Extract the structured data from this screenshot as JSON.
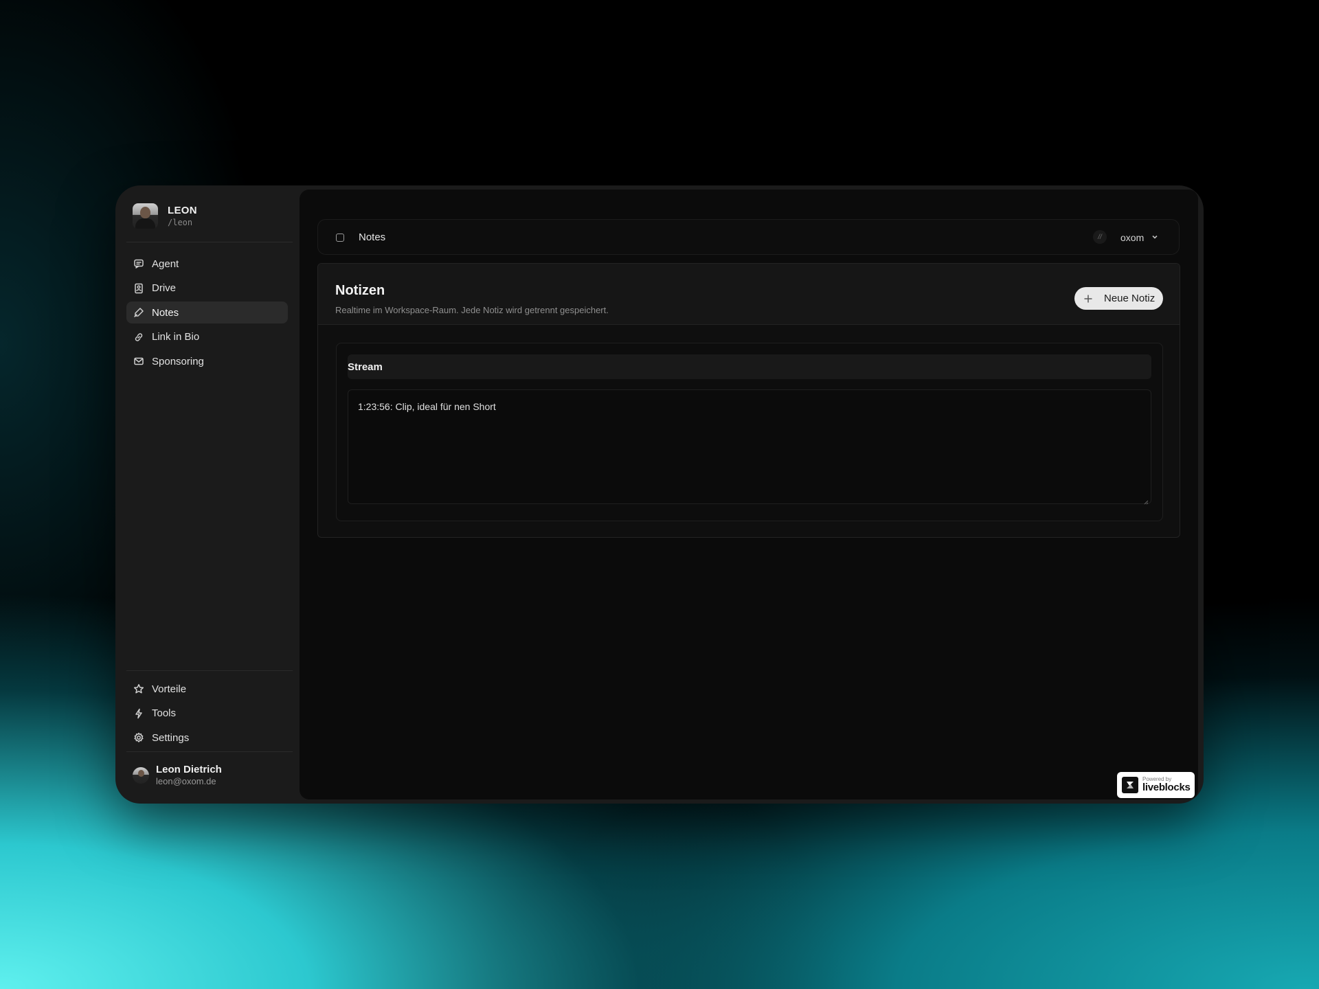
{
  "sidebar": {
    "profile": {
      "name": "LEON",
      "handle": "/leon"
    },
    "nav": [
      {
        "label": "Agent",
        "icon": "chat-icon"
      },
      {
        "label": "Drive",
        "icon": "drive-icon"
      },
      {
        "label": "Notes",
        "icon": "pen-icon",
        "active": true
      },
      {
        "label": "Link in Bio",
        "icon": "link-icon"
      },
      {
        "label": "Sponsoring",
        "icon": "mail-icon"
      }
    ],
    "bottom_nav": [
      {
        "label": "Vorteile",
        "icon": "star-icon"
      },
      {
        "label": "Tools",
        "icon": "bolt-icon"
      },
      {
        "label": "Settings",
        "icon": "gear-icon"
      }
    ],
    "user": {
      "name": "Leon Dietrich",
      "email": "leon@oxom.de"
    }
  },
  "topbar": {
    "title": "Notes",
    "workspace": {
      "name": "oxom",
      "icon_text": "//"
    }
  },
  "panel": {
    "heading": "Notizen",
    "subtitle": "Realtime im Workspace-Raum. Jede Notiz wird getrennt gespeichert.",
    "new_button": "Neue Notiz"
  },
  "note": {
    "title": "Stream",
    "body": "1:23:56: Clip, ideal für nen Short"
  },
  "badge": {
    "small": "Powered by",
    "brand": "liveblocks"
  }
}
